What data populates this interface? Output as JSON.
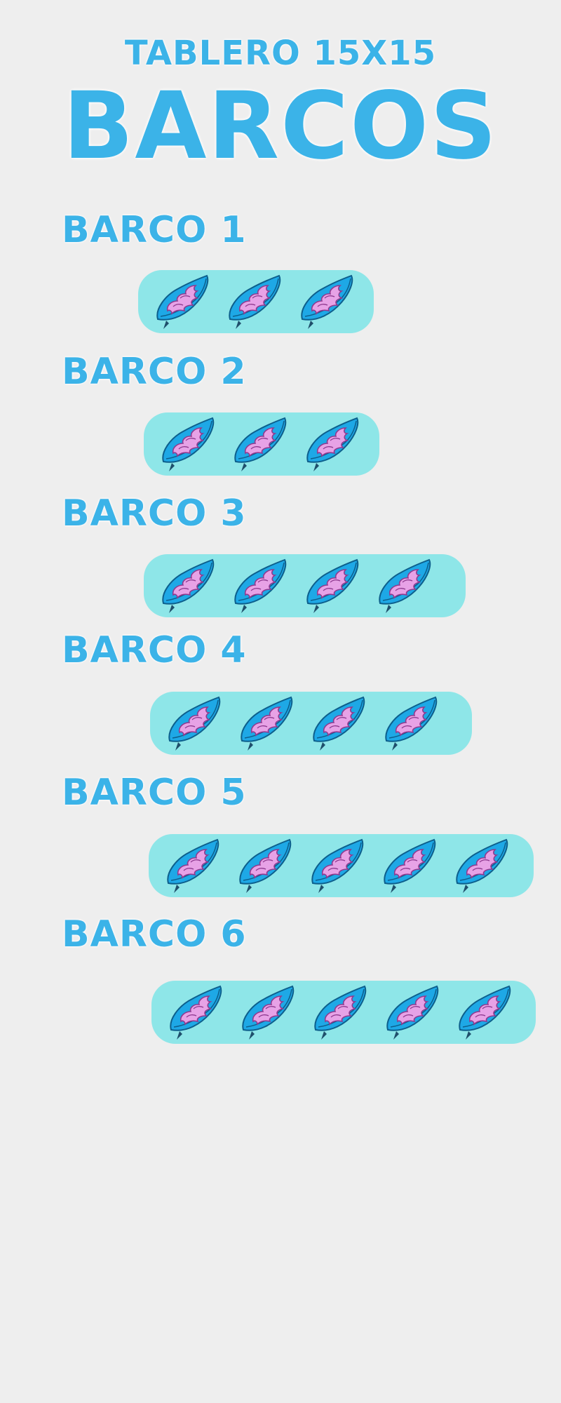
{
  "header": {
    "subtitle": "TABLERO 15X15",
    "title": "BARCOS"
  },
  "colors": {
    "background": "#eeeeee",
    "title_blue": "#3bb3e8",
    "tray_cyan": "#8ee6e8",
    "board_blue": "#1ea8e6",
    "wave_pink": "#e7a2e6"
  },
  "piece_icon": "surfboard-icon",
  "ships": [
    {
      "label": "BARCO 1",
      "size": 3
    },
    {
      "label": "BARCO 2",
      "size": 3
    },
    {
      "label": "BARCO 3",
      "size": 4
    },
    {
      "label": "BARCO 4",
      "size": 4
    },
    {
      "label": "BARCO 5",
      "size": 5
    },
    {
      "label": "BARCO 6",
      "size": 5
    }
  ]
}
